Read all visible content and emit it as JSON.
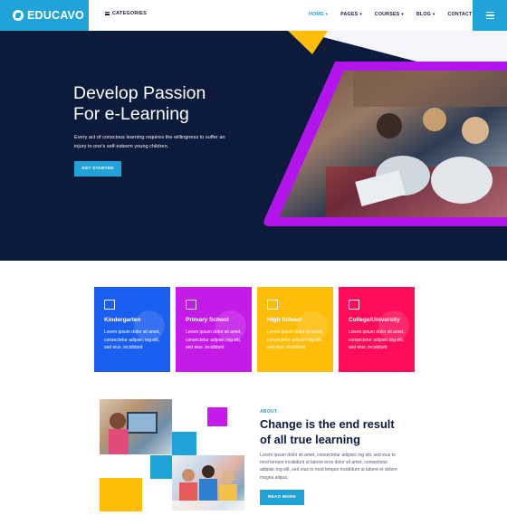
{
  "nav": {
    "logo_text": "EDUCAVO",
    "categories_label": "CATEGORIES",
    "items": [
      {
        "label": "HOME",
        "active": true
      },
      {
        "label": "PAGES",
        "active": false
      },
      {
        "label": "COURSES",
        "active": false
      },
      {
        "label": "BLOG",
        "active": false
      },
      {
        "label": "CONTACT",
        "active": false
      }
    ]
  },
  "hero": {
    "title_line1": "Develop Passion",
    "title_line2": "For e-Learning",
    "description": "Every act of conscious learning requires the willingness to suffer an injury to one's self-esteem young children.",
    "button_label": "GET STARTED"
  },
  "cards": [
    {
      "title": "Kindergarten",
      "text": "Lorem ipsum dolor sit amet, consectetur adipisic ing elit, sed eius .incididunt",
      "color": "#1b5ff0",
      "icon": "abc-blocks-icon"
    },
    {
      "title": "Primary School",
      "text": "Lorem ipsum dolor sit amet, consectetur adipisic ing elit, sed eius .incididunt",
      "color": "#c51be9",
      "icon": "board-icon"
    },
    {
      "title": "High School",
      "text": "Lorem ipsum dolor sit amet, consectetur adipisic ing elit, sed eius .incididunt",
      "color": "#fdbd08",
      "icon": "clipboard-icon"
    },
    {
      "title": "College/University",
      "text": "Lorem ipsum dolor sit amet, consectetur adipisic ing elit, sed eius .incididunt",
      "color": "#ff0d5b",
      "icon": "university-icon"
    }
  ],
  "about": {
    "eyebrow": "ABOUT",
    "title_line1": "Change is the end result",
    "title_line2": "of all true learning",
    "text": "Lorem ipsum dolor sit amet, consectetur adipisic ing elit, sed eius to mod tempor incididunt ut labore eros dolor sit amet, consectetur adipisic ing elit, sed eius to mod tempor incididunt ut labore et dolore magna aliqua.",
    "button_label": "READ MORE"
  },
  "colors": {
    "brand": "#1fa3d8",
    "hero_bg": "#0c1a3c",
    "accent_yellow": "#fdbd08",
    "accent_magenta": "#c51be9"
  }
}
